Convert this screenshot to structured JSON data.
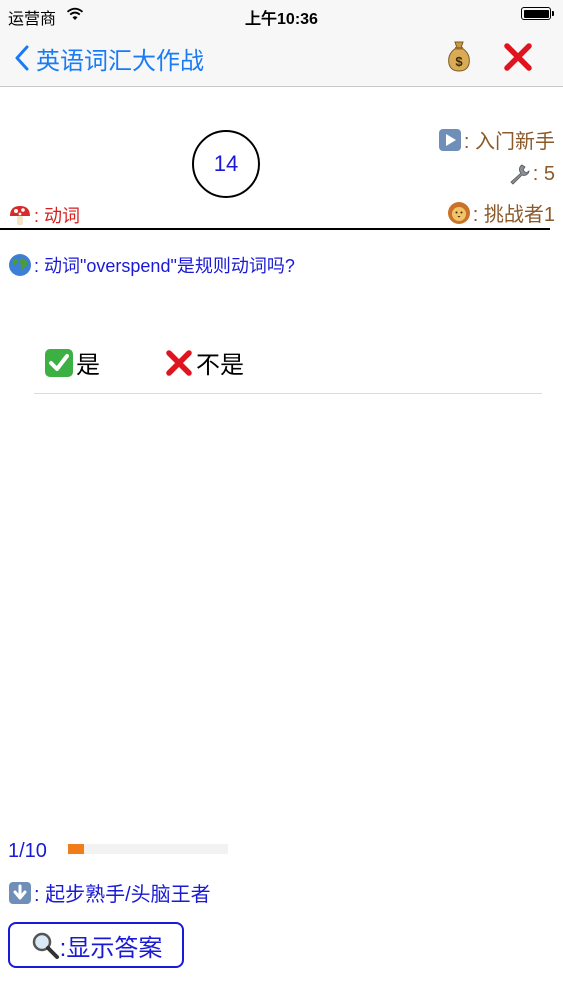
{
  "status_bar": {
    "carrier": "运营商",
    "time": "上午10:36"
  },
  "nav": {
    "back_label": "英语词汇大作战"
  },
  "timer": {
    "value": "14"
  },
  "info": {
    "level_label": ": 入门新手",
    "tools_count": ": 5",
    "player_label": ": 挑战者1",
    "category_label": ": 动词"
  },
  "question": {
    "text": ": 动词\"overspend\"是规则动词吗?"
  },
  "options": {
    "yes_label": "是",
    "no_label": "不是"
  },
  "progress": {
    "label": "1/10",
    "fraction": 0.1
  },
  "level_range": {
    "label": ": 起步熟手/头脑王者"
  },
  "answer_button": {
    "label": ":显示答案"
  },
  "colors": {
    "accent_blue": "#1a7cf5",
    "text_blue": "#1a1ad6",
    "brown": "#8b5a2b",
    "red": "#d81e1e",
    "orange": "#f07c1a"
  }
}
